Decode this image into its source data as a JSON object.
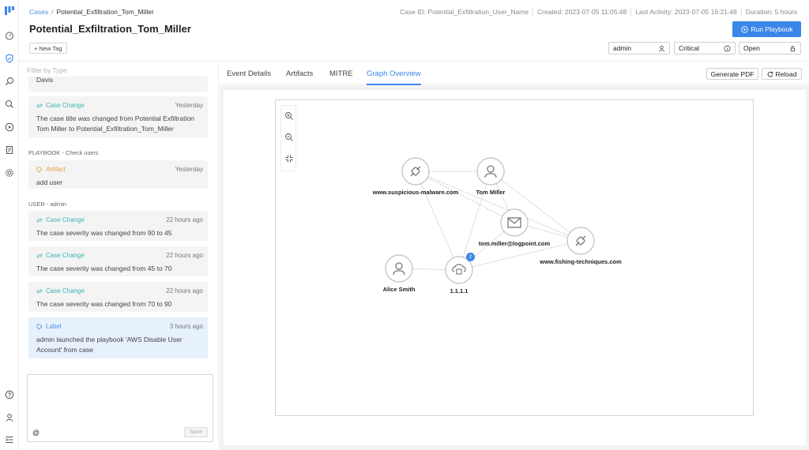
{
  "header": {
    "breadcrumb_root": "Cases",
    "breadcrumb_sep": "/",
    "breadcrumb_current": "Potential_Exfiltration_Tom_Miller",
    "title": "Potential_Exfiltration_Tom_Miller",
    "case_id": "Case ID: Potential_Exfiltration_User_Name",
    "created": "Created: 2023-07-05 11:05:48",
    "last_activity": "Last Activity: 2023-07-05 16:21:48",
    "duration": "Duration: 5 hours",
    "run_playbook_label": "Run Playbook",
    "new_tag_label": "+ New Tag",
    "assignee": "admin",
    "severity": "Critical",
    "status": "Open"
  },
  "feed": {
    "filter_placeholder": "Filter by Type",
    "top_text": "Davis",
    "items": [
      {
        "type": "Case Change",
        "time": "Yesterday",
        "text": "The case title was changed from Potential Exfiltration Tom Miller to Potential_Exfiltration_Tom_Miller"
      },
      {
        "group": "PLAYBOOK - Check users"
      },
      {
        "type": "Artifact",
        "time": "Yesterday",
        "text": "add user"
      },
      {
        "group": "USER - admin"
      },
      {
        "type": "Case Change",
        "time": "22 hours ago",
        "text": "The case severity was changed from 90 to 45"
      },
      {
        "type": "Case Change",
        "time": "22 hours ago",
        "text": "The case severity was changed from 45 to 70"
      },
      {
        "type": "Case Change",
        "time": "22 hours ago",
        "text": "The case severity was changed from 70 to 90"
      },
      {
        "type": "Label",
        "time": "3 hours ago",
        "text": "admin launched the playbook 'AWS Disable User Account' from case"
      }
    ],
    "comment_prefix": "@",
    "save_label": "Save"
  },
  "tabs": {
    "event_details": "Event Details",
    "artifacts": "Artifacts",
    "mitre": "MITRE",
    "graph_overview": "Graph Overview",
    "active": "Graph Overview",
    "generate_pdf": "Generate PDF",
    "reload": "Reload"
  },
  "graph": {
    "nodes": [
      {
        "id": "n1",
        "label": "www.suspicious-malware.com",
        "icon": "link-icon"
      },
      {
        "id": "n2",
        "label": "Tom Miller",
        "icon": "user-icon"
      },
      {
        "id": "n3",
        "label": "tom.miller@logpoint.com",
        "icon": "mail-icon"
      },
      {
        "id": "n4",
        "label": "www.fishing-techniques.com",
        "icon": "link-icon"
      },
      {
        "id": "n5",
        "label": "Alice Smith",
        "icon": "user-icon"
      },
      {
        "id": "n6",
        "label": "1.1.1.1",
        "icon": "network-icon",
        "badge": "2"
      }
    ],
    "edges": [
      [
        "n1",
        "n2"
      ],
      [
        "n1",
        "n3"
      ],
      [
        "n1",
        "n6"
      ],
      [
        "n2",
        "n3"
      ],
      [
        "n2",
        "n4"
      ],
      [
        "n2",
        "n6"
      ],
      [
        "n3",
        "n4"
      ],
      [
        "n3",
        "n6"
      ],
      [
        "n6",
        "n4"
      ],
      [
        "n5",
        "n6"
      ],
      [
        "n1",
        "n4"
      ]
    ]
  },
  "colors": {
    "accent": "#3b86e8",
    "teal": "#3bb3b3",
    "orange": "#e0a030"
  }
}
